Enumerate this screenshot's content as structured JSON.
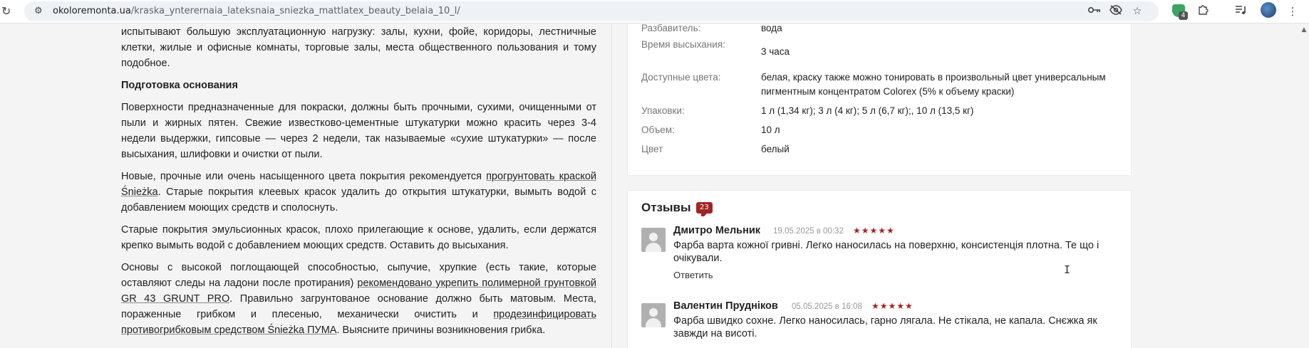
{
  "browser": {
    "url_domain": "okoloremonta.ua",
    "url_path": "/kraska_ynterernaia_lateksnaia_sniezka_mattlatex_beauty_belaia_10_l/",
    "extension_badge_count": "4",
    "icons": [
      "reload-icon",
      "site-info-icon",
      "password-key-icon",
      "eye-off-icon",
      "bookmark-star-icon",
      "extension-shield-icon",
      "extensions-puzzle-icon",
      "media-queue-icon",
      "profile-avatar",
      "more-menu-icon"
    ]
  },
  "article": {
    "p1": "испытывают большую эксплуатационную нагрузку: залы, кухни, фойе, коридоры, лестничные клетки, жилые и офисные комнаты, торговые залы, места общественного пользования и тому подобное.",
    "heading": "Подготовка основания",
    "p2": "Поверхности предназначенные для покраски, должны быть прочными, сухими, очищенными от пыли и жирных пятен. Свежие известково-цементные штукатурки можно красить через 3-4 недели выдержки, гипсовые — через 2 недели, так называемые «сухие штукатурки» — после высыхания, шлифовки и очистки от пыли.",
    "p3_before": "Новые, прочные или очень насыщенного цвета покрытия рекомендуется ",
    "p3_link": "прогрунтовать краской Śnieżka",
    "p3_after": ".  Старые покрытия клеевых красок удалить до открытия штукатурки, вымыть водой с добавлением моющих средств и сполоснуть.",
    "p4": "Старые покрытия эмульсионных красок, плохо прилегающие к основе, удалить, если держатся крепко вымыть водой с добавлением моющих средств. Оставить до высыхания.",
    "p5_before": "Основы с высокой поглощающей способностью, сыпучие, хрупкие (есть такие, которые оставляют следы на ладони после протирания) ",
    "p5_link1": "рекомендовано укрепить полимерной грунтовкой GR 43 GRUNT PRO",
    "p5_mid": ".  Правильно загрунтованое основание должно быть матовым. Места, пораженные грибком и плесенью, механически очистить и ",
    "p5_link2": "продезинфицировать противогрибковым средством Śnieżka ПУМА",
    "p5_after": ".  Выясните причины возникновения грибка."
  },
  "specs": {
    "rows": [
      {
        "label": "Разбавитель:",
        "value": "вода"
      },
      {
        "label": "Время высыхания:",
        "value": "3 часа"
      },
      {
        "label": "Доступные цвета:",
        "value": "белая, краску также можно тонировать в произвольный цвет универсальным пигментным концентратом Colorex (5% к объему краски)"
      },
      {
        "label": "Упаковки:",
        "value": "1 л (1,34 кг); 3 л (4 кг); 5 л (6,7 кг);, 10 л (13,5 кг)"
      },
      {
        "label": "Объем:",
        "value": "10 л"
      },
      {
        "label": "Цвет",
        "value": "белый"
      }
    ]
  },
  "reviews": {
    "title": "Отзывы",
    "count": "23",
    "stars": "★★★★★",
    "reply_label": "Ответить",
    "items": [
      {
        "author": "Дмитро Мельник",
        "date": "19.05.2025 в 00:32",
        "rating": 5,
        "text": "Фарба варта кожної гривні. Легко наносилась на поверхню, консистенція плотна. Те що і очікували."
      },
      {
        "author": "Валентин Прудніков",
        "date": "05.05.2025 в 16:08",
        "rating": 5,
        "text": "Фарба швидко сохне. Легко наносилась, гарно лягала. Не стікала, не капала. Снєжка як завжди на висоті."
      }
    ]
  }
}
